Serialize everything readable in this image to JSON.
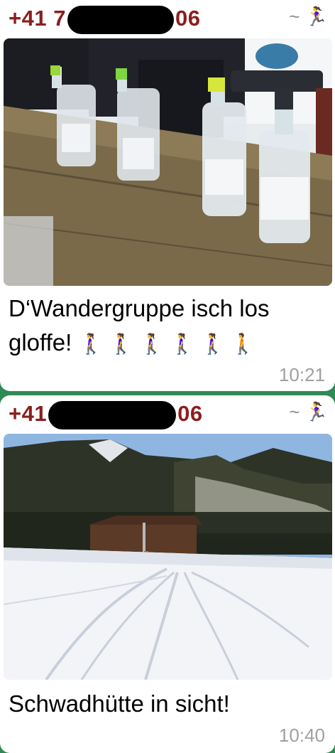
{
  "messages": [
    {
      "sender_prefix": "+41 7",
      "sender_suffix": "06",
      "push_name": "~",
      "push_icon": "running-person-emoji",
      "photo_desc_icon": "bottles-on-table-photo",
      "text": "D‘Wandergruppe isch los gloffe!",
      "emojis": "🚶‍♀️🚶‍♀️🚶‍♀️🚶‍♀️🚶‍♀️🚶",
      "time": "10:21"
    },
    {
      "sender_prefix": "+41",
      "sender_suffix": "06",
      "push_name": "~",
      "push_icon": "running-person-emoji",
      "photo_desc_icon": "ski-slope-mountain-photo",
      "text": "Schwadhütte in sicht!",
      "time": "10:40"
    }
  ],
  "colors": {
    "sender": "#8b1e1e",
    "timestamp": "#a0a0a0",
    "chat_background": "#2f8a55"
  }
}
